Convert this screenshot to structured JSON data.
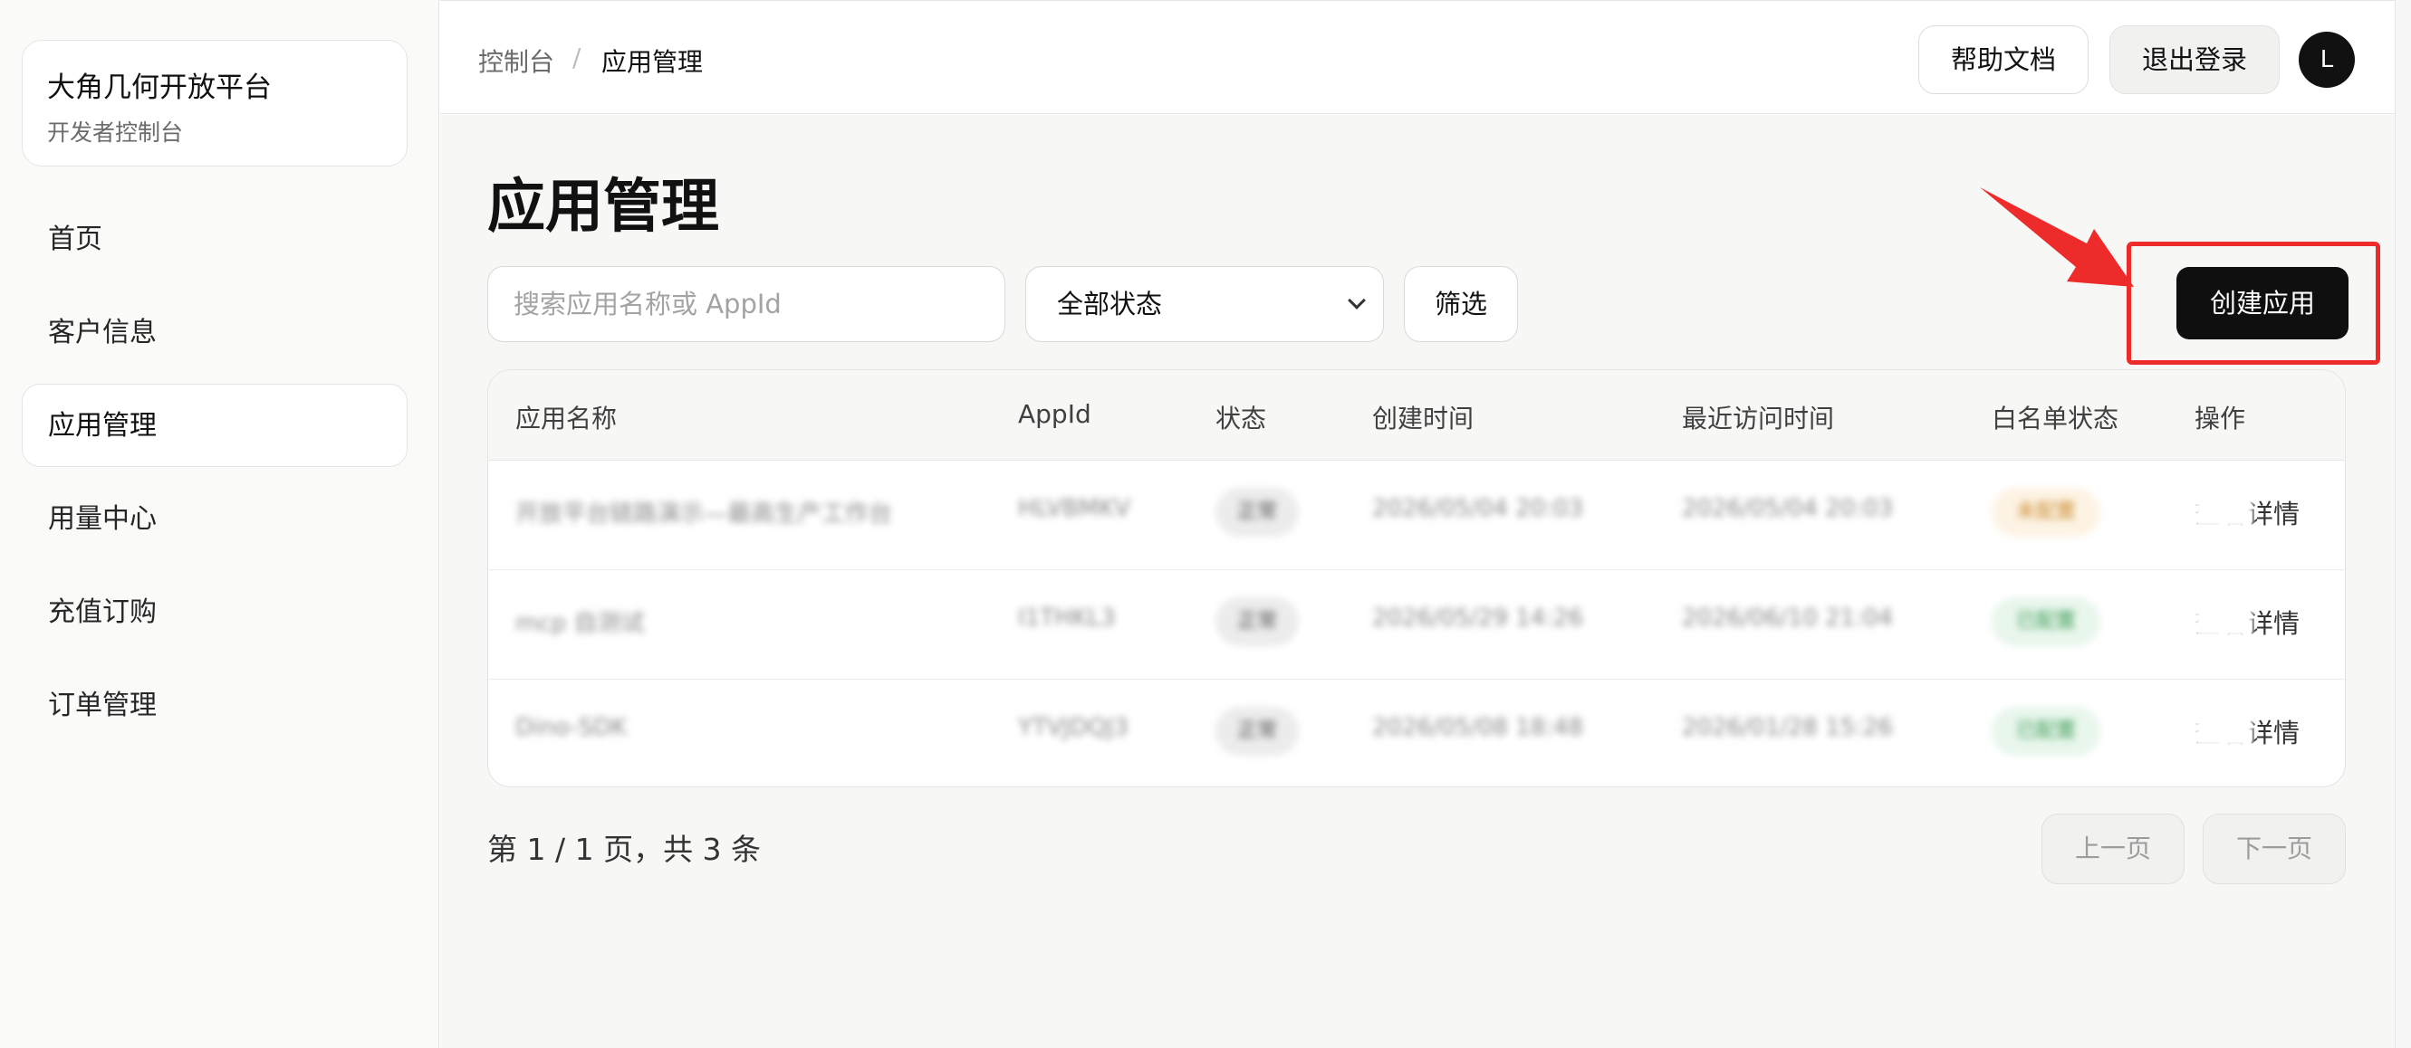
{
  "sidebar": {
    "brand_title": "大角几何开放平台",
    "brand_subtitle": "开发者控制台",
    "items": [
      {
        "label": "首页"
      },
      {
        "label": "客户信息"
      },
      {
        "label": "应用管理",
        "active": true
      },
      {
        "label": "用量中心"
      },
      {
        "label": "充值订购"
      },
      {
        "label": "订单管理"
      }
    ]
  },
  "header": {
    "breadcrumb": [
      "控制台",
      "/",
      "应用管理"
    ],
    "help_label": "帮助文档",
    "logout_label": "退出登录",
    "avatar_initial": "L"
  },
  "main": {
    "title": "应用管理",
    "search_placeholder": "搜索应用名称或 AppId",
    "status_select": "全部状态",
    "filter_label": "筛选",
    "create_label": "创建应用",
    "table": {
      "columns": [
        "应用名称",
        "AppId",
        "状态",
        "创建时间",
        "最近访问时间",
        "白名单状态",
        "操作"
      ],
      "rows": [
        {
          "name": "开放平台链路演示—最高生产工作台",
          "appid": "HLVBMKV",
          "status": "正常",
          "created": "2026/05/04 20:03",
          "last_visit": "2026/05/04 20:03",
          "whitelist": "未配置",
          "whitelist_color": "#fdf3e4",
          "whitelist_text_color": "#c98a2a",
          "action": "查看详情"
        },
        {
          "name": "mcp 自测试",
          "appid": "I1THKL3",
          "status": "正常",
          "created": "2026/05/29 14:26",
          "last_visit": "2026/06/10 21:04",
          "whitelist": "已配置",
          "whitelist_color": "#e8f6ec",
          "whitelist_text_color": "#3a9a55",
          "action": "查看详情"
        },
        {
          "name": "Dino-SDK",
          "appid": "YTVJDQJ3",
          "status": "正常",
          "created": "2026/05/08 18:48",
          "last_visit": "2026/01/28 15:26",
          "whitelist": "已配置",
          "whitelist_color": "#e8f6ec",
          "whitelist_text_color": "#3a9a55",
          "action": "查看详情"
        }
      ]
    },
    "pagination": {
      "info": "第 1 / 1 页，共 3 条",
      "prev_label": "上一页",
      "next_label": "下一页"
    }
  },
  "colors": {
    "accent_dark": "#0f0f0f",
    "annotation_red": "#ee2b2b"
  }
}
